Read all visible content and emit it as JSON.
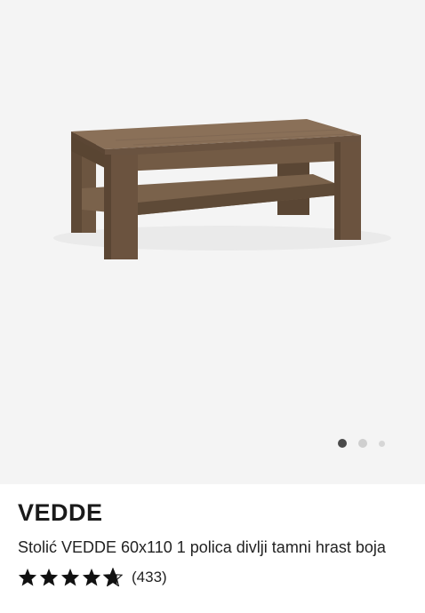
{
  "product": {
    "brand": "VEDDE",
    "description": "Stolić VEDDE 60x110 1 polica divlji tamni hrast boja",
    "rating": 4.7,
    "rating_count": "(433)",
    "stars": [
      "full",
      "full",
      "full",
      "full",
      "partial"
    ]
  },
  "gallery": {
    "image_alt": "Stolić VEDDE",
    "active_index": 0,
    "dots": 3
  },
  "colors": {
    "image_background": "#f4f4f4",
    "wood": "#6f5843",
    "active_dot": "#4a4a4a"
  }
}
